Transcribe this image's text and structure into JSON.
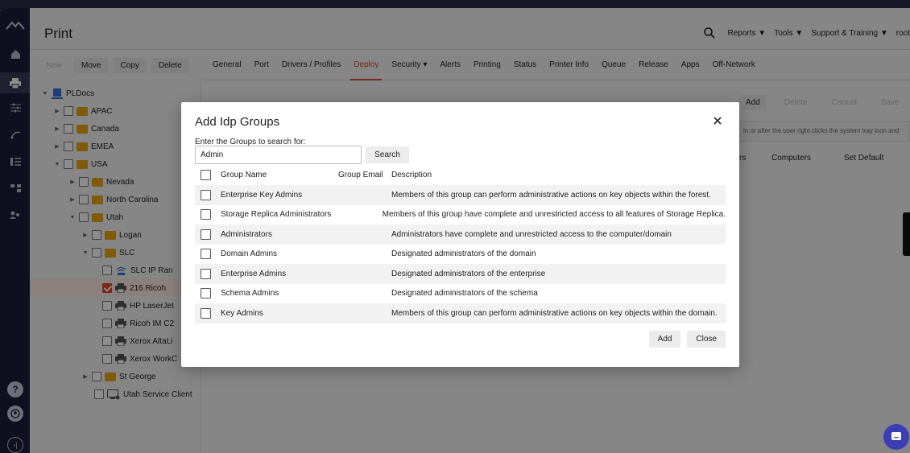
{
  "app": {
    "title": "Print"
  },
  "header": {
    "nav": [
      "Reports ▼",
      "Tools ▼",
      "Support & Training ▼",
      "root"
    ]
  },
  "tree_toolbar": {
    "new": "New",
    "move": "Move",
    "copy": "Copy",
    "delete": "Delete"
  },
  "tabs": [
    "General",
    "Port",
    "Drivers / Profiles",
    "Deploy",
    "Security ▾",
    "Alerts",
    "Printing",
    "Status",
    "Printer Info",
    "Queue",
    "Release",
    "Apps",
    "Off-Network"
  ],
  "active_tab": "Deploy",
  "tree": {
    "root": "PLDocs",
    "items": [
      "APAC",
      "Canada",
      "EMEA",
      "USA",
      "Nevada",
      "North Carolina",
      "Utah",
      "Logan",
      "SLC",
      "SLC IP Ran",
      "216 Ricoh",
      "HP LaserJet",
      "Ricoh IM C2",
      "Xerox AltaLi",
      "Xerox WorkC",
      "St George",
      "Utah Service Client"
    ]
  },
  "background_panel": {
    "add": "Add",
    "delete": "Delete",
    "cancel": "Cancel",
    "save": "Save",
    "info": "in or after the user right clicks the system tray icon and",
    "col_rs": "rs",
    "col_computers": "Computers",
    "col_default": "Set Default"
  },
  "dialog": {
    "title": "Add Idp Groups",
    "search_label": "Enter the Groups to search for:",
    "search_value": "Admin",
    "search_button": "Search",
    "columns": {
      "name": "Group Name",
      "email": "Group Email",
      "description": "Description"
    },
    "rows": [
      {
        "name": "Enterprise Key Admins",
        "email": "",
        "description": "Members of this group can perform administrative actions on key objects within the forest."
      },
      {
        "name": "Storage Replica Administrators",
        "email": "",
        "description": "Members of this group have complete and unrestricted access to all features of Storage Replica."
      },
      {
        "name": "Administrators",
        "email": "",
        "description": "Administrators have complete and unrestricted access to the computer/domain"
      },
      {
        "name": "Domain Admins",
        "email": "",
        "description": "Designated administrators of the domain"
      },
      {
        "name": "Enterprise Admins",
        "email": "",
        "description": "Designated administrators of the enterprise"
      },
      {
        "name": "Schema Admins",
        "email": "",
        "description": "Designated administrators of the schema"
      },
      {
        "name": "Key Admins",
        "email": "",
        "description": "Members of this group can perform administrative actions on key objects within the domain."
      }
    ],
    "add_button": "Add",
    "close_button": "Close"
  },
  "colors": {
    "accent": "#d9462e",
    "rail": "#1b1d3a",
    "folder": "#e6a817",
    "chat": "#3b3fb6"
  }
}
